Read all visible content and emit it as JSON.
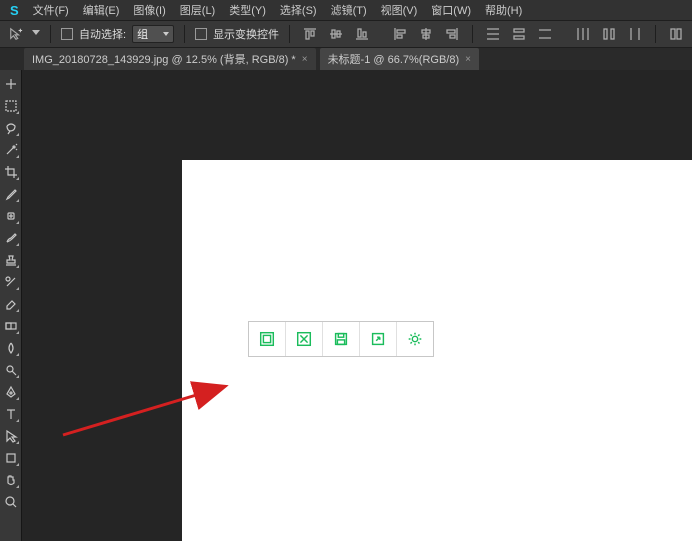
{
  "logo": "S",
  "menu": [
    "文件(F)",
    "编辑(E)",
    "图像(I)",
    "图层(L)",
    "类型(Y)",
    "选择(S)",
    "滤镜(T)",
    "视图(V)",
    "窗口(W)",
    "帮助(H)"
  ],
  "toolbar": {
    "auto_select_label": "自动选择:",
    "group_label": "组",
    "show_transform_label": "显示变换控件"
  },
  "tabs": [
    {
      "label": "IMG_20180728_143929.jpg @ 12.5% (背景, RGB/8) *"
    },
    {
      "label": "未标题-1 @ 66.7%(RGB/8)"
    }
  ],
  "overlay_buttons": [
    "original-size",
    "fullscreen",
    "save",
    "share",
    "settings"
  ]
}
